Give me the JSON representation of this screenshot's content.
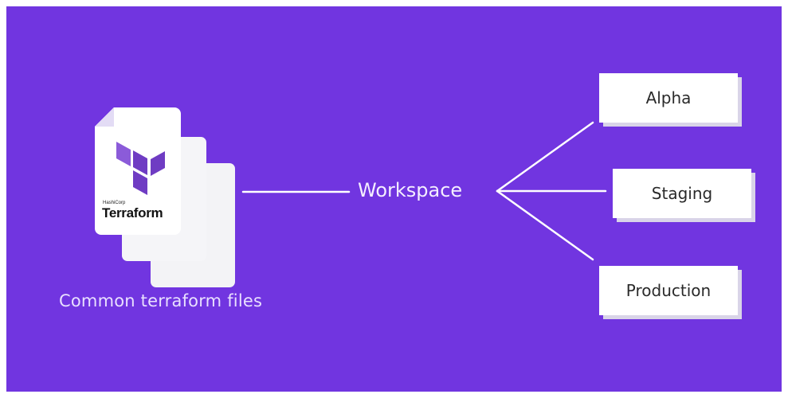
{
  "diagram": {
    "background_color": "#7135e0",
    "source": {
      "brand_small": "HashiCorp",
      "brand_name": "Terraform",
      "caption": "Common terraform files",
      "icon": "terraform-file-stack-icon"
    },
    "hub": {
      "label": "Workspace"
    },
    "environments": [
      {
        "label": "Alpha"
      },
      {
        "label": "Staging"
      },
      {
        "label": "Production"
      }
    ]
  }
}
